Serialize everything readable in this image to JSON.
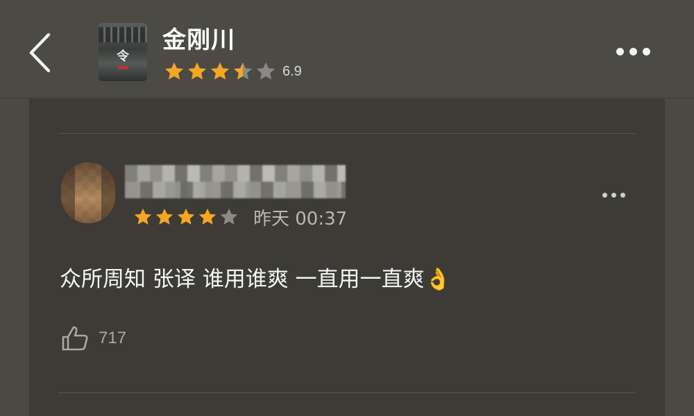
{
  "header": {
    "back_icon": "chevron-left-icon",
    "title": "金刚川",
    "rating_value": 6.9,
    "rating_text": "6.9",
    "rating_stars": 3.5,
    "more_icon": "more-horizontal-icon"
  },
  "comment": {
    "rating_stars": 4,
    "time": "昨天 00:37",
    "text": "众所周知 张译 谁用谁爽 一直用一直爽👌",
    "likes": "717",
    "like_icon": "thumbs-up-icon",
    "more_icon": "more-horizontal-icon"
  },
  "colors": {
    "background": "#4a4944",
    "card": "#3c3b36",
    "star_active": "#f5a623",
    "star_inactive": "#8a8985"
  }
}
